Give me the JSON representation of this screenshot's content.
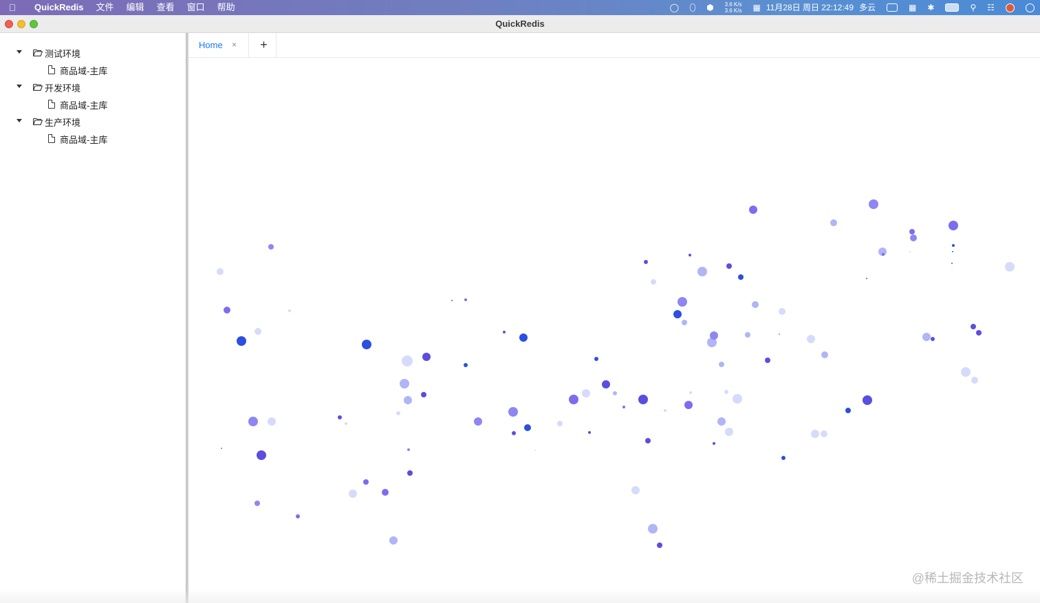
{
  "menubar": {
    "apple_icon": "apple-icon",
    "app_name": "QuickRedis",
    "menus": [
      "文件",
      "编辑",
      "查看",
      "窗口",
      "帮助"
    ],
    "net_up": "3.6 K/s",
    "net_down": "3.6 K/s",
    "datetime": "11月28日 周日 22:12:49",
    "weather": "多云"
  },
  "window": {
    "title": "QuickRedis"
  },
  "sidebar": {
    "groups": [
      {
        "label": "测试环境",
        "children": [
          "商品域-主库"
        ]
      },
      {
        "label": "开发环境",
        "children": [
          "商品域-主库"
        ]
      },
      {
        "label": "生产环境",
        "children": [
          "商品域-主库"
        ]
      }
    ]
  },
  "tabs": {
    "items": [
      {
        "label": "Home",
        "close": "×"
      }
    ],
    "add_label": "+"
  },
  "colors": {
    "accent": "#1677ff",
    "particle_palette": [
      "#2b4fe0",
      "#5a4ee0",
      "#7b6cf0",
      "#8e86f2",
      "#b0b5f5",
      "#d6dbfb"
    ]
  },
  "watermark": "@稀土掘金技术社区"
}
